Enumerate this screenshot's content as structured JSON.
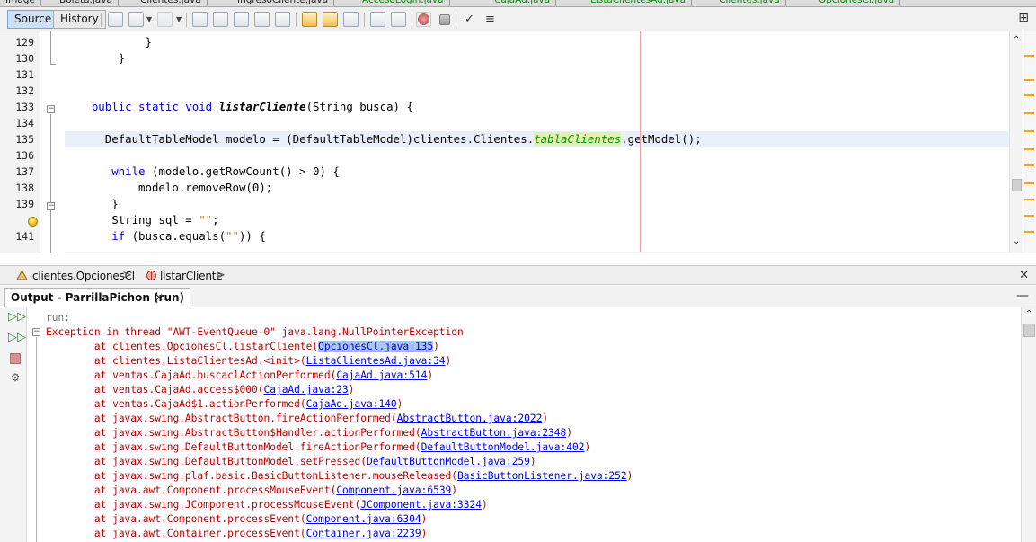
{
  "window": {
    "file_tabs": [
      {
        "label": "Image",
        "color": "#222222"
      },
      {
        "label": "Boleta.java",
        "color": "#222222"
      },
      {
        "label": "Clientes.java",
        "color": "#222222"
      },
      {
        "label": "IngresoCliente.java",
        "color": "#222222"
      },
      {
        "label": "AccesoLogin.java",
        "color": "#168a16"
      },
      {
        "label": "CajaAd.java",
        "color": "#168a16"
      },
      {
        "label": "ListaClientesAd.java",
        "color": "#168a16"
      },
      {
        "label": "Clientes.java",
        "color": "#168a16"
      },
      {
        "label": "OpcionesCl.java",
        "color": "#168a16"
      }
    ]
  },
  "toolbar": {
    "source_label": "Source",
    "history_label": "History",
    "maximize_glyph": "⊞"
  },
  "editor": {
    "line_numbers": [
      "129",
      "130",
      "131",
      "132",
      "133",
      "134",
      "135",
      "136",
      "137",
      "138",
      "139",
      "",
      "141"
    ],
    "current_line_index": 6,
    "highlight_color": "#e9eff8",
    "lines": [
      {
        "segments": [
          {
            "t": "            }",
            "c": ""
          }
        ]
      },
      {
        "segments": [
          {
            "t": "        }",
            "c": ""
          }
        ]
      },
      {
        "segments": [
          {
            "t": "",
            "c": ""
          }
        ]
      },
      {
        "segments": [
          {
            "t": "",
            "c": ""
          }
        ]
      },
      {
        "segments": [
          {
            "t": "    ",
            "c": ""
          },
          {
            "t": "public static void ",
            "c": "kw"
          },
          {
            "t": "listarCliente",
            "c": "mth"
          },
          {
            "t": "(String busca) {",
            "c": ""
          }
        ]
      },
      {
        "segments": [
          {
            "t": "",
            "c": ""
          }
        ]
      },
      {
        "segments": [
          {
            "t": "      DefaultTableModel modelo = (DefaultTableModel)clientes.Clientes.",
            "c": ""
          },
          {
            "t": "tablaClientes",
            "c": "fld"
          },
          {
            "t": ".getModel();",
            "c": ""
          }
        ]
      },
      {
        "segments": [
          {
            "t": "",
            "c": ""
          }
        ]
      },
      {
        "segments": [
          {
            "t": "       ",
            "c": ""
          },
          {
            "t": "while",
            "c": "kw"
          },
          {
            "t": " (modelo.getRowCount() > 0) {",
            "c": ""
          }
        ]
      },
      {
        "segments": [
          {
            "t": "           modelo.removeRow(0);",
            "c": ""
          }
        ]
      },
      {
        "segments": [
          {
            "t": "       }",
            "c": ""
          }
        ]
      },
      {
        "segments": [
          {
            "t": "       String sql = ",
            "c": ""
          },
          {
            "t": "\"\"",
            "c": "str"
          },
          {
            "t": ";",
            "c": ""
          }
        ]
      },
      {
        "segments": [
          {
            "t": "       ",
            "c": ""
          },
          {
            "t": "if",
            "c": "kw"
          },
          {
            "t": " (busca.equals(",
            "c": ""
          },
          {
            "t": "\"\"",
            "c": "str"
          },
          {
            "t": ")) {",
            "c": ""
          }
        ]
      }
    ],
    "hint_marker": "lightbulb",
    "stripe_color": "#f2a71d"
  },
  "breadcrumb": {
    "class_label": "clientes.OpcionesCl",
    "method_label": "listarCliente",
    "close_glyph": "✕"
  },
  "output": {
    "tab_label": "Output - ParrillaPichon (run)",
    "close_glyph": "✕",
    "minimize_glyph": "—",
    "error_color": "#c00000",
    "link_color": "#0000ee",
    "lines": [
      {
        "text": "run:",
        "link": "",
        "tail": "",
        "kind": "run"
      },
      {
        "text": "Exception in thread \"AWT-EventQueue-0\" java.lang.NullPointerException",
        "link": "",
        "tail": "",
        "kind": "err"
      },
      {
        "text": "        at clientes.OpcionesCl.listarCliente(",
        "link": "OpcionesCl.java:135",
        "tail": ")",
        "kind": "err",
        "selected": true
      },
      {
        "text": "        at clientes.ListaClientesAd.<init>(",
        "link": "ListaClientesAd.java:34",
        "tail": ")",
        "kind": "err"
      },
      {
        "text": "        at ventas.CajaAd.buscaclActionPerformed(",
        "link": "CajaAd.java:514",
        "tail": ")",
        "kind": "err"
      },
      {
        "text": "        at ventas.CajaAd.access$000(",
        "link": "CajaAd.java:23",
        "tail": ")",
        "kind": "err"
      },
      {
        "text": "        at ventas.CajaAd$1.actionPerformed(",
        "link": "CajaAd.java:140",
        "tail": ")",
        "kind": "err"
      },
      {
        "text": "        at javax.swing.AbstractButton.fireActionPerformed(",
        "link": "AbstractButton.java:2022",
        "tail": ")",
        "kind": "err"
      },
      {
        "text": "        at javax.swing.AbstractButton$Handler.actionPerformed(",
        "link": "AbstractButton.java:2348",
        "tail": ")",
        "kind": "err"
      },
      {
        "text": "        at javax.swing.DefaultButtonModel.fireActionPerformed(",
        "link": "DefaultButtonModel.java:402",
        "tail": ")",
        "kind": "err"
      },
      {
        "text": "        at javax.swing.DefaultButtonModel.setPressed(",
        "link": "DefaultButtonModel.java:259",
        "tail": ")",
        "kind": "err"
      },
      {
        "text": "        at javax.swing.plaf.basic.BasicButtonListener.mouseReleased(",
        "link": "BasicButtonListener.java:252",
        "tail": ")",
        "kind": "err"
      },
      {
        "text": "        at java.awt.Component.processMouseEvent(",
        "link": "Component.java:6539",
        "tail": ")",
        "kind": "err"
      },
      {
        "text": "        at javax.swing.JComponent.processMouseEvent(",
        "link": "JComponent.java:3324",
        "tail": ")",
        "kind": "err"
      },
      {
        "text": "        at java.awt.Component.processEvent(",
        "link": "Component.java:6304",
        "tail": ")",
        "kind": "err"
      },
      {
        "text": "        at java.awt.Container.processEvent(",
        "link": "Container.java:2239",
        "tail": ")",
        "kind": "err"
      }
    ]
  }
}
